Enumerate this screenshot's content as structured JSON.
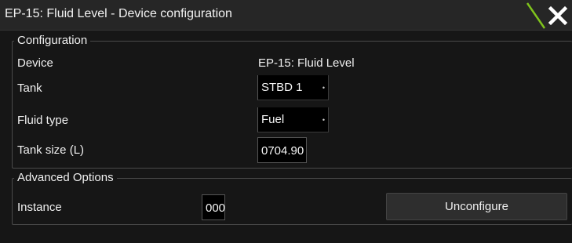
{
  "dialog": {
    "title": "EP-15: Fluid Level - Device configuration",
    "close_icon": "close-x-icon",
    "accent_color": "#7fc31c"
  },
  "configuration": {
    "legend": "Configuration",
    "device_label": "Device",
    "device_value": "EP-15: Fluid Level",
    "tank_label": "Tank",
    "tank_value": "STBD 1",
    "fluid_type_label": "Fluid type",
    "fluid_type_value": "Fuel",
    "tank_size_label": "Tank size (L)",
    "tank_size_value": "0704.90"
  },
  "advanced": {
    "legend": "Advanced Options",
    "instance_label": "Instance",
    "instance_value": "000",
    "unconfigure_label": "Unconfigure"
  }
}
